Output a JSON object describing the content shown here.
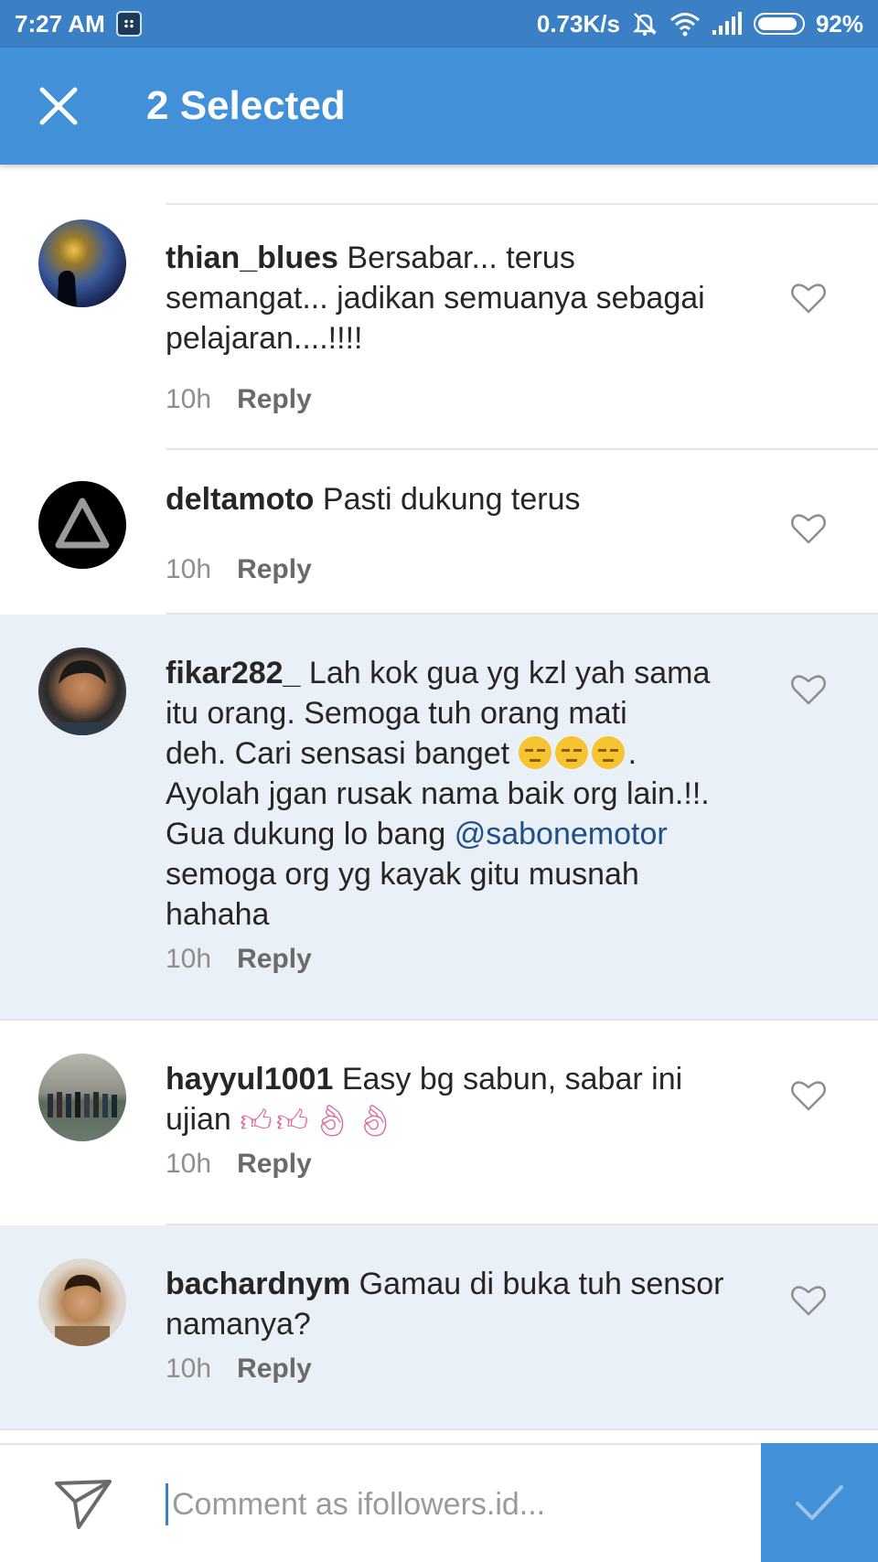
{
  "status_bar": {
    "time": "7:27 AM",
    "net_speed": "0.73K/s",
    "battery": "92%",
    "battery_level": 0.92,
    "icons": [
      "bbm-icon",
      "mute-icon",
      "wifi-icon",
      "signal-icon",
      "battery-icon"
    ]
  },
  "action_bar": {
    "title": "2 Selected",
    "close_icon": "close-icon"
  },
  "colors": {
    "status_bar": "#3b7fc4",
    "action_bar": "#4190d8",
    "selected_row": "#e9f0f8",
    "mention": "#1f4f86"
  },
  "comments": [
    {
      "username": "thian_blues",
      "lines": [
        "Bersabar... terus",
        "semangat... jadikan semuanya sebagai",
        "pelajaran....!!!!"
      ],
      "time": "10h",
      "reply": "Reply",
      "selected": false
    },
    {
      "username": "deltamoto",
      "lines": [
        "Pasti dukung terus"
      ],
      "time": "10h",
      "reply": "Reply",
      "selected": false
    },
    {
      "username": "fikar282_",
      "text_1": "Lah kok gua yg kzl yah sama",
      "text_2": "itu orang. Semoga tuh orang mati",
      "text_3": "deh. Cari sensasi banget",
      "text_3_end": ".",
      "text_4": "Ayolah jgan rusak nama baik org lain.!!.",
      "text_5": "Gua dukung lo bang",
      "mention": "@sabonemotor",
      "text_6": "semoga org yg kayak gitu musnah",
      "text_7": "hahaha",
      "emoji": "expressionless-face",
      "time": "10h",
      "reply": "Reply",
      "selected": true
    },
    {
      "username": "hayyul1001",
      "text_1": "Easy bg sabun, sabar ini",
      "text_2": "ujian",
      "emojis": [
        "thumbs-up",
        "thumbs-up",
        "ok-hand",
        "ok-hand"
      ],
      "time": "10h",
      "reply": "Reply",
      "selected": false
    },
    {
      "username": "bachardnym",
      "lines": [
        "Gamau di buka tuh sensor",
        "namanya?"
      ],
      "time": "10h",
      "reply": "Reply",
      "selected": true
    }
  ],
  "composer": {
    "placeholder": "Comment as ifollowers.id...",
    "value": "",
    "send_icon": "send-icon",
    "post_icon": "checkmark-icon"
  }
}
